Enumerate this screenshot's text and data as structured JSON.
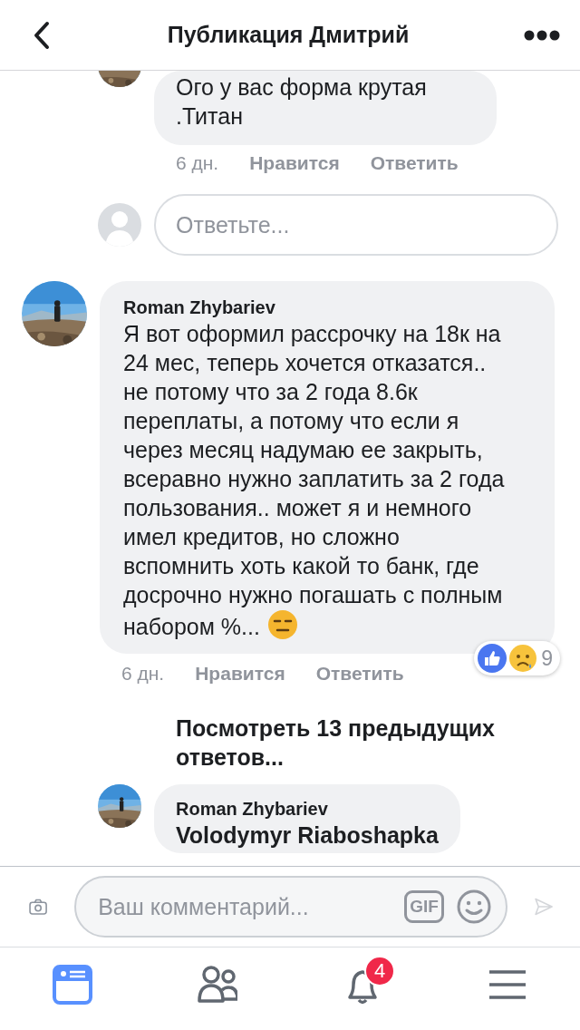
{
  "header": {
    "title": "Публикация Дмитрий"
  },
  "feed": [
    {
      "kind": "reply",
      "text": "Ого у вас форма крутая .Титан",
      "time": "6 дн.",
      "actions": [
        "Нравится",
        "Ответить"
      ]
    },
    {
      "kind": "reply_box",
      "placeholder": "Ответьте..."
    },
    {
      "kind": "comment",
      "author": "Roman Zhybariev",
      "text": "Я вот оформил рассрочку на 18к на 24 мес, теперь хочется отказатся.. не потому что за 2 года 8.6к переплаты, а потому что если я через месяц надумаю ее закрыть, всеравно нужно заплатить за 2 года пользования.. может я и немного имел кредитов, но сложно вспомнить хоть какой то банк, где досрочно нужно погашать с полным набором %...",
      "time": "6 дн.",
      "actions": [
        "Нравится",
        "Ответить"
      ],
      "reaction_count": "9"
    },
    {
      "kind": "more",
      "text": "Посмотреть 13 предыдущих ответов..."
    },
    {
      "kind": "reply",
      "author": "Roman Zhybariev",
      "mention": "Volodymyr Riaboshapka"
    }
  ],
  "composer": {
    "placeholder": "Ваш комментарий...",
    "gif_label": "GIF"
  },
  "tabs": [
    {
      "kind": "feed",
      "selected": true
    },
    {
      "kind": "friends",
      "selected": false
    },
    {
      "kind": "notifications",
      "selected": false,
      "badge": "4"
    },
    {
      "kind": "menu",
      "selected": false
    }
  ]
}
